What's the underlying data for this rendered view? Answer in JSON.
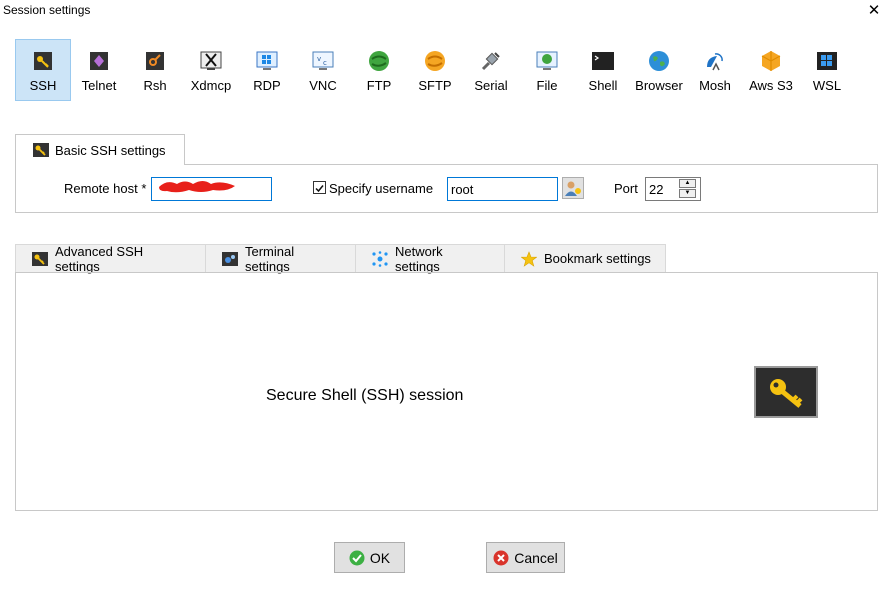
{
  "window": {
    "title": "Session settings",
    "close_glyph": "✕"
  },
  "protocols": [
    {
      "label": "SSH",
      "icon": "ssh-icon",
      "active": true
    },
    {
      "label": "Telnet",
      "icon": "telnet-icon"
    },
    {
      "label": "Rsh",
      "icon": "rsh-icon"
    },
    {
      "label": "Xdmcp",
      "icon": "xdmcp-icon"
    },
    {
      "label": "RDP",
      "icon": "rdp-icon"
    },
    {
      "label": "VNC",
      "icon": "vnc-icon"
    },
    {
      "label": "FTP",
      "icon": "ftp-icon"
    },
    {
      "label": "SFTP",
      "icon": "sftp-icon"
    },
    {
      "label": "Serial",
      "icon": "serial-icon"
    },
    {
      "label": "File",
      "icon": "file-icon"
    },
    {
      "label": "Shell",
      "icon": "shell-icon"
    },
    {
      "label": "Browser",
      "icon": "browser-icon"
    },
    {
      "label": "Mosh",
      "icon": "mosh-icon"
    },
    {
      "label": "Aws S3",
      "icon": "aws-s3-icon"
    },
    {
      "label": "WSL",
      "icon": "wsl-icon"
    }
  ],
  "basic": {
    "tab_label": "Basic SSH settings",
    "remote_host_label": "Remote host *",
    "remote_host_value": "",
    "specify_username_label": "Specify username",
    "specify_username_checked": true,
    "username_value": "root",
    "port_label": "Port",
    "port_value": "22"
  },
  "advanced_tabs": [
    {
      "label": "Advanced SSH settings",
      "icon": "key-icon"
    },
    {
      "label": "Terminal settings",
      "icon": "terminal-icon"
    },
    {
      "label": "Network settings",
      "icon": "network-icon"
    },
    {
      "label": "Bookmark settings",
      "icon": "star-icon"
    }
  ],
  "panel": {
    "description": "Secure Shell (SSH) session"
  },
  "buttons": {
    "ok_label": "OK",
    "cancel_label": "Cancel"
  },
  "colors": {
    "accent": "#0078d7",
    "active_bg": "#cce4f7",
    "ok": "#3cb043",
    "cancel": "#d9342b",
    "key": "#f5c211"
  }
}
